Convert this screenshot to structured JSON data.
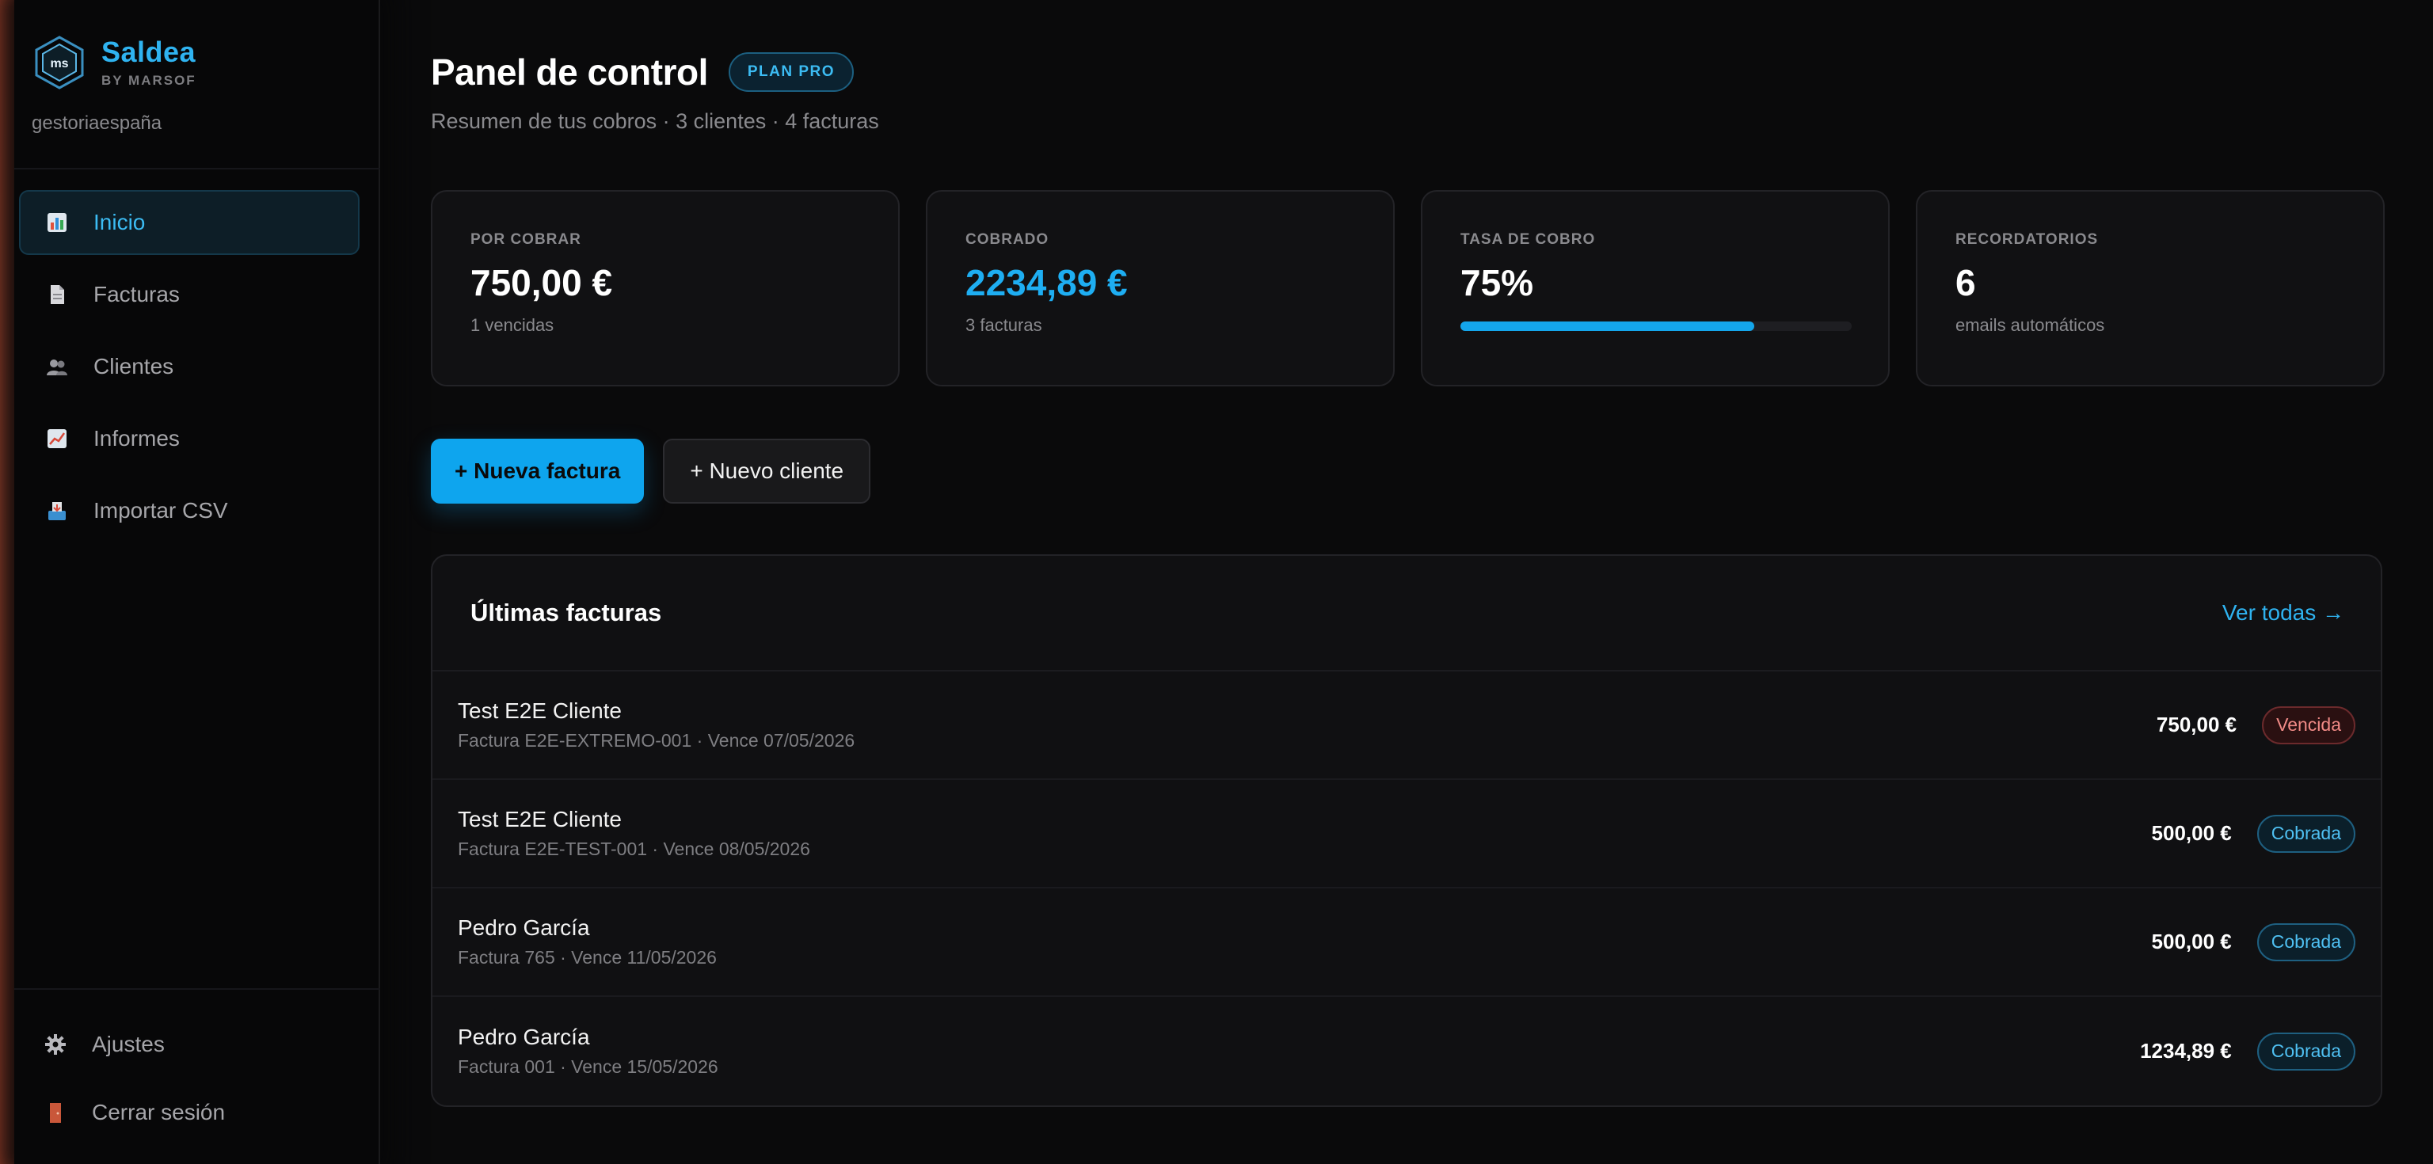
{
  "brand": {
    "name": "Saldea",
    "by": "BY MARSOF",
    "logo_text": "ms",
    "org": "gestoriaespaña"
  },
  "sidebar": {
    "items": [
      {
        "label": "Inicio",
        "icon": "bar-chart-icon",
        "active": true
      },
      {
        "label": "Facturas",
        "icon": "document-icon",
        "active": false
      },
      {
        "label": "Clientes",
        "icon": "users-icon",
        "active": false
      },
      {
        "label": "Informes",
        "icon": "line-chart-icon",
        "active": false
      },
      {
        "label": "Importar CSV",
        "icon": "inbox-tray-icon",
        "active": false
      }
    ],
    "bottom": [
      {
        "label": "Ajustes",
        "icon": "gear-icon"
      },
      {
        "label": "Cerrar sesión",
        "icon": "door-icon"
      }
    ]
  },
  "header": {
    "title": "Panel de control",
    "plan": "PLAN PRO",
    "subtitle": "Resumen de tus cobros · 3 clientes · 4 facturas"
  },
  "stats": [
    {
      "label": "POR COBRAR",
      "value": "750,00 €",
      "sub": "1 vencidas"
    },
    {
      "label": "COBRADO",
      "value": "2234,89 €",
      "sub": "3 facturas"
    },
    {
      "label": "TASA DE COBRO",
      "value": "75%",
      "progress": 0.75
    },
    {
      "label": "RECORDATORIOS",
      "value": "6",
      "sub": "emails automáticos"
    }
  ],
  "actions": {
    "new_invoice": "+ Nueva factura",
    "new_client": "+ Nuevo cliente"
  },
  "invoices": {
    "title": "Últimas facturas",
    "view_all": "Ver todas →",
    "rows": [
      {
        "client": "Test E2E Cliente",
        "meta": "Factura E2E-EXTREMO-001 · Vence 07/05/2026",
        "amount": "750,00 €",
        "status": "Vencida"
      },
      {
        "client": "Test E2E Cliente",
        "meta": "Factura E2E-TEST-001 · Vence 08/05/2026",
        "amount": "500,00 €",
        "status": "Cobrada"
      },
      {
        "client": "Pedro García",
        "meta": "Factura 765 · Vence 11/05/2026",
        "amount": "500,00 €",
        "status": "Cobrada"
      },
      {
        "client": "Pedro García",
        "meta": "Factura 001 · Vence 15/05/2026",
        "amount": "1234,89 €",
        "status": "Cobrada"
      }
    ]
  },
  "colors": {
    "accent": "#0ea5ee",
    "overdue": "#f08a86",
    "paid": "#4fc0f2",
    "sidebar_glow": "#d9674a"
  }
}
